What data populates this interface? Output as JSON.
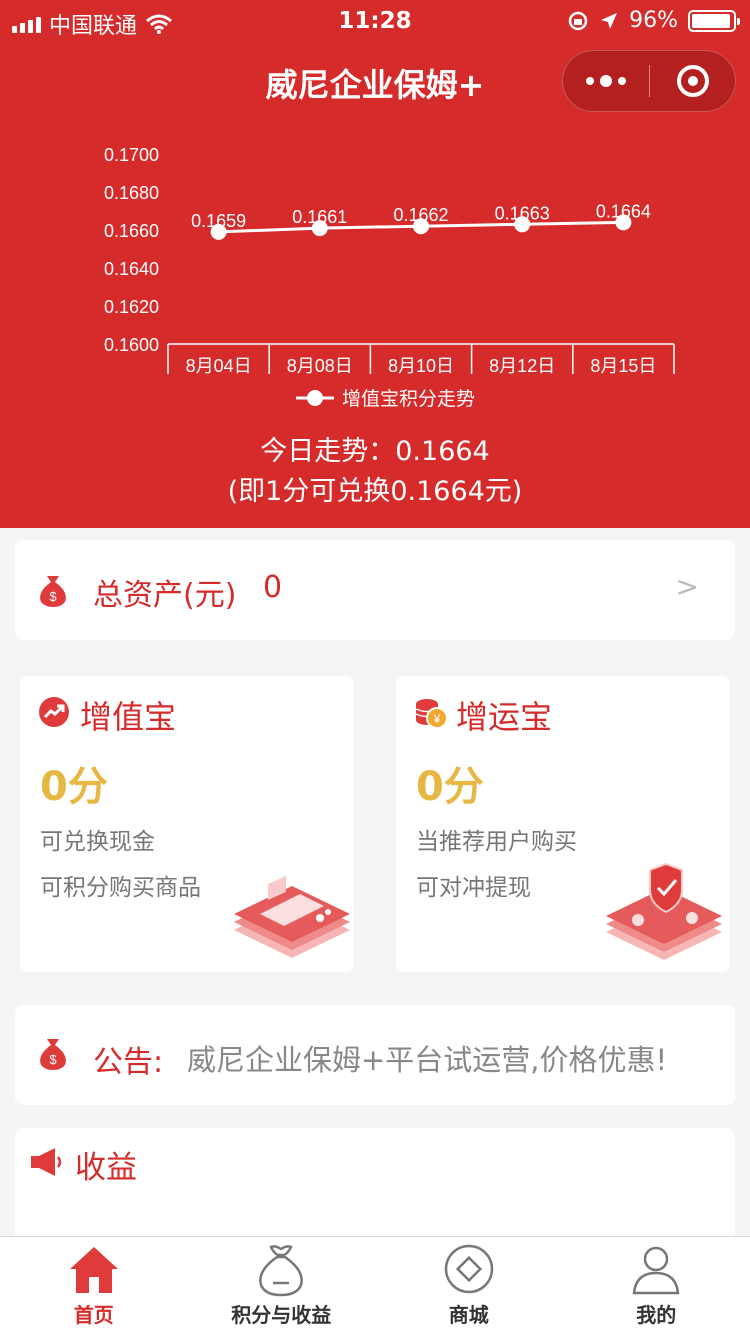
{
  "status_bar": {
    "carrier": "中国联通",
    "time": "11:28",
    "battery": "96%",
    "battery_level": 0.96
  },
  "nav": {
    "title": "威尼企业保姆+"
  },
  "chart_data": {
    "type": "line",
    "categories": [
      "8月04日",
      "8月08日",
      "8月10日",
      "8月12日",
      "8月15日"
    ],
    "series": [
      {
        "name": "增值宝积分走势",
        "values": [
          0.1659,
          0.1661,
          0.1662,
          0.1663,
          0.1664
        ]
      }
    ],
    "value_labels": [
      "0.1659",
      "0.1661",
      "0.1662",
      "0.1663",
      "0.1664"
    ],
    "y_ticks": [
      "0.1600",
      "0.1620",
      "0.1640",
      "0.1660",
      "0.1680",
      "0.1700"
    ],
    "ylim": [
      0.16,
      0.17
    ],
    "grid": false,
    "legend": "bottom",
    "line_color": "#ffffff"
  },
  "trend": {
    "today": "今日走势：0.1664",
    "exchange": "(即1分可兑换0.1664元)"
  },
  "assets": {
    "label": "总资产(元)",
    "value": "0",
    "arrow": ">"
  },
  "products": [
    {
      "title": "增值宝",
      "points": "0分",
      "line1": "可兑换现金",
      "line2": "可积分购买商品",
      "icon": "trend-up-icon"
    },
    {
      "title": "增运宝",
      "points": "0分",
      "line1": "当推荐用户购买",
      "line2": "可对冲提现",
      "icon": "coins-icon"
    }
  ],
  "notice": {
    "label": "公告:",
    "text": "威尼企业保姆+平台试运营,价格优惠!"
  },
  "income": {
    "title": "收益"
  },
  "tabs": [
    {
      "label": "首页",
      "icon": "home-icon",
      "active": true
    },
    {
      "label": "积分与收益",
      "icon": "money-bag-icon",
      "active": false
    },
    {
      "label": "商城",
      "icon": "shop-icon",
      "active": false
    },
    {
      "label": "我的",
      "icon": "profile-icon",
      "active": false
    }
  ],
  "colors": {
    "brand_red": "#d52b2b",
    "points_gold": "#e6b843"
  }
}
